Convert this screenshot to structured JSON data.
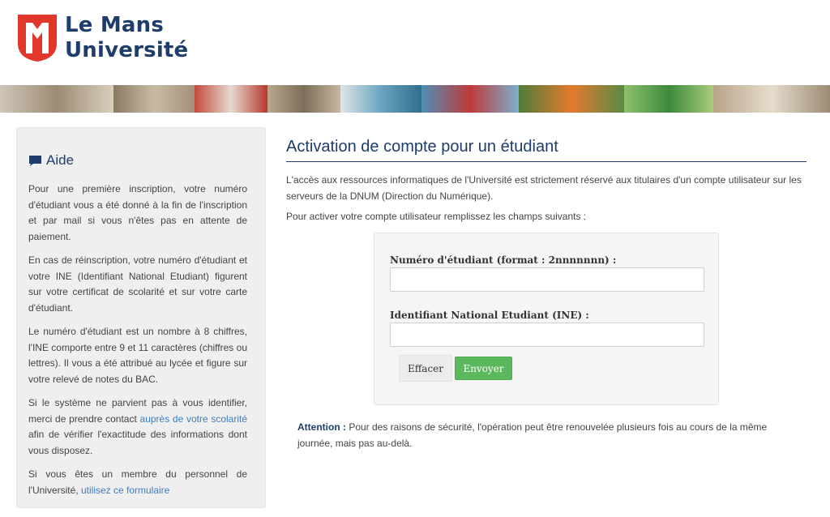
{
  "header": {
    "logo_line1": "Le Mans",
    "logo_line2": "Université"
  },
  "sidebar": {
    "title": "Aide",
    "p1": "Pour une première inscription, votre numéro d'étudiant vous a été donné à la fin de l'inscription et par mail si vous n'êtes pas en attente de paiement.",
    "p2": "En cas de réinscription, votre numéro d'étudiant et votre INE (Identifiant National Etudiant) figurent sur votre certificat de scolarité et sur votre carte d'étudiant.",
    "p3": "Le numéro d'étudiant est un nombre à 8 chiffres, l'INE comporte entre 9 et 11 caractères (chiffres ou lettres). Il vous a été attribué au lycée et figure sur votre relevé de notes du BAC.",
    "p4_before": "Si le système ne parvient pas à vous identifier, merci de prendre contact ",
    "p4_link": "auprès de votre scolarité",
    "p4_after": " afin de vérifier l'exactitude des informations dont vous disposez.",
    "p5_before": "Si vous êtes un membre du personnel de l'Université, ",
    "p5_link": "utilisez ce formulaire"
  },
  "main": {
    "title": "Activation de compte pour un étudiant",
    "intro": "L'accès aux ressources informatiques de l'Université est strictement réservé aux titulaires d'un compte utilisateur sur les serveurs de la DNUM (Direction du Numérique).",
    "instruction": "Pour activer votre compte utilisateur remplissez les champs suivants :"
  },
  "form": {
    "student_number_label": "Numéro d'étudiant (format : 2nnnnnnn) :",
    "student_number_value": "",
    "ine_label": "Identifiant National Etudiant (INE) :",
    "ine_value": "",
    "clear_label": "Effacer",
    "submit_label": "Envoyer"
  },
  "attention": {
    "label": "Attention :",
    "text": " Pour des raisons de sécurité, l'opération peut être renouvelée plusieurs fois au cours de la même journée, mais pas au-delà."
  },
  "colors": {
    "brand_red": "#e2382b",
    "brand_navy": "#1e3d6b",
    "submit_green": "#5cb85c",
    "link_blue": "#3b7ec9"
  }
}
